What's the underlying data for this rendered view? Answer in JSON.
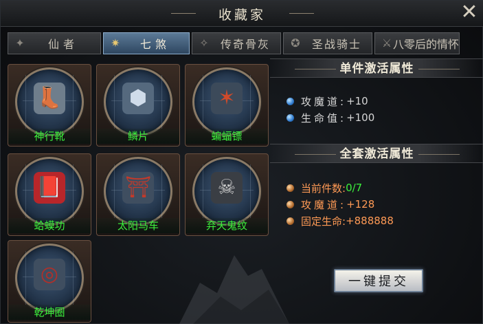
{
  "window": {
    "title": "收藏家"
  },
  "tabs": [
    {
      "label": "仙者",
      "icon": "ghost-crest-icon",
      "active": false
    },
    {
      "label": "七煞",
      "icon": "wing-crest-icon",
      "active": true
    },
    {
      "label": "传奇骨灰",
      "icon": "bone-crest-icon",
      "active": false
    },
    {
      "label": "圣战骑士",
      "icon": "knight-crest-icon",
      "active": false
    },
    {
      "label": "八零后的情怀",
      "icon": "spear-crest-icon",
      "active": false
    }
  ],
  "items": [
    {
      "name": "神行靴",
      "icon": "boots-icon",
      "glyph": "👢"
    },
    {
      "name": "鳞片",
      "icon": "scale-armor-icon",
      "glyph": "🛡"
    },
    {
      "name": "蝙蝠镖",
      "icon": "bat-dart-icon",
      "glyph": "✶"
    },
    {
      "name": "蛤蟆功",
      "icon": "manual-book-icon",
      "glyph": "📕"
    },
    {
      "name": "太阳马车",
      "icon": "chariot-icon",
      "glyph": "🏮"
    },
    {
      "name": "弃天鬼纹",
      "icon": "skull-icon",
      "glyph": "💀"
    },
    {
      "name": "乾坤圈",
      "icon": "bead-bracelet-icon",
      "glyph": "📿"
    }
  ],
  "single_set": {
    "heading": "单件激活属性",
    "attributes": [
      {
        "key": "攻魔道:",
        "value": "+10"
      },
      {
        "key": "生命值:",
        "value": "+100"
      }
    ]
  },
  "full_set": {
    "heading": "全套激活属性",
    "count_label": "当前件数:",
    "count_value": "0/7",
    "attributes": [
      {
        "key": "攻魔道:",
        "value": "+128"
      },
      {
        "key": "固定生命:",
        "value": "+888888"
      }
    ]
  },
  "submit_label": "一键提交",
  "colors": {
    "item_name": "#3cf03c",
    "full_set_text": "#ff9a55",
    "active_tab": "#4d6d8c"
  }
}
